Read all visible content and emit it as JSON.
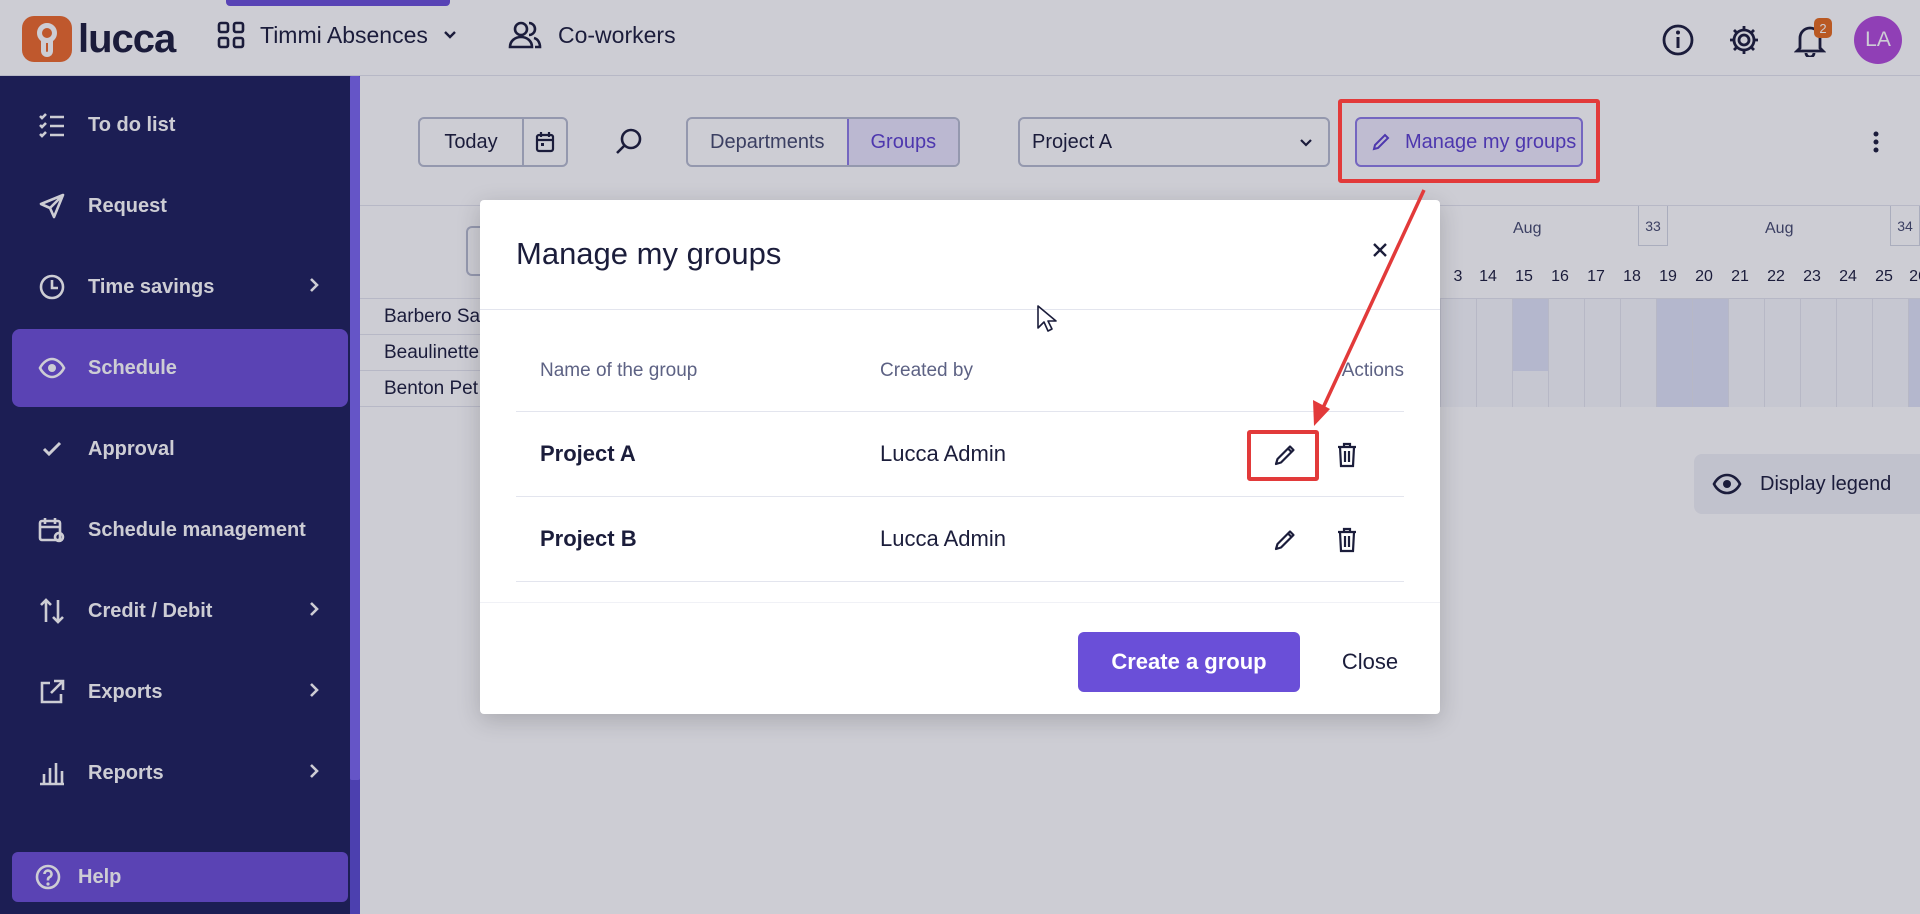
{
  "topbar": {
    "logo_text": "lucca",
    "app_switch_label": "Timmi Absences",
    "coworkers_label": "Co-workers",
    "notification_count": "2",
    "avatar_initials": "LA"
  },
  "sidebar": {
    "items": [
      {
        "label": "To do list",
        "icon": "checklist-icon"
      },
      {
        "label": "Request",
        "icon": "paper-plane-icon"
      },
      {
        "label": "Time savings",
        "icon": "clock-icon"
      },
      {
        "label": "Schedule",
        "icon": "eye-icon"
      },
      {
        "label": "Approval",
        "icon": "check-icon"
      },
      {
        "label": "Schedule management",
        "icon": "calendar-gear-icon"
      },
      {
        "label": "Credit / Debit",
        "icon": "arrows-updown-icon"
      },
      {
        "label": "Exports",
        "icon": "external-link-icon"
      },
      {
        "label": "Reports",
        "icon": "bar-chart-icon"
      }
    ],
    "help_label": "Help"
  },
  "toolbar": {
    "today_label": "Today",
    "segment": [
      "Departments",
      "Groups"
    ],
    "group_select_value": "Project A",
    "manage_groups_label": "Manage my groups"
  },
  "schedule": {
    "month_labels": [
      "Aug",
      "Aug"
    ],
    "week_numbers": [
      "33",
      "34"
    ],
    "days": [
      "3",
      "14",
      "15",
      "16",
      "17",
      "18",
      "19",
      "20",
      "21",
      "22",
      "23",
      "24",
      "25",
      "26"
    ],
    "rows": [
      "Barbero Sa",
      "Beaulinette",
      "Benton Pet"
    ],
    "legend_label": "Display legend"
  },
  "modal": {
    "title": "Manage my groups",
    "columns": {
      "name": "Name of the group",
      "created_by": "Created by",
      "actions": "Actions"
    },
    "rows": [
      {
        "name": "Project A",
        "created_by": "Lucca Admin"
      },
      {
        "name": "Project B",
        "created_by": "Lucca Admin"
      }
    ],
    "create_label": "Create a group",
    "close_label": "Close"
  },
  "colors": {
    "brand": "#6a4fd8",
    "sidebar_bg": "#1d1f5c",
    "annotation_red": "#e23a3a",
    "logo_orange": "#ee6a2a"
  }
}
